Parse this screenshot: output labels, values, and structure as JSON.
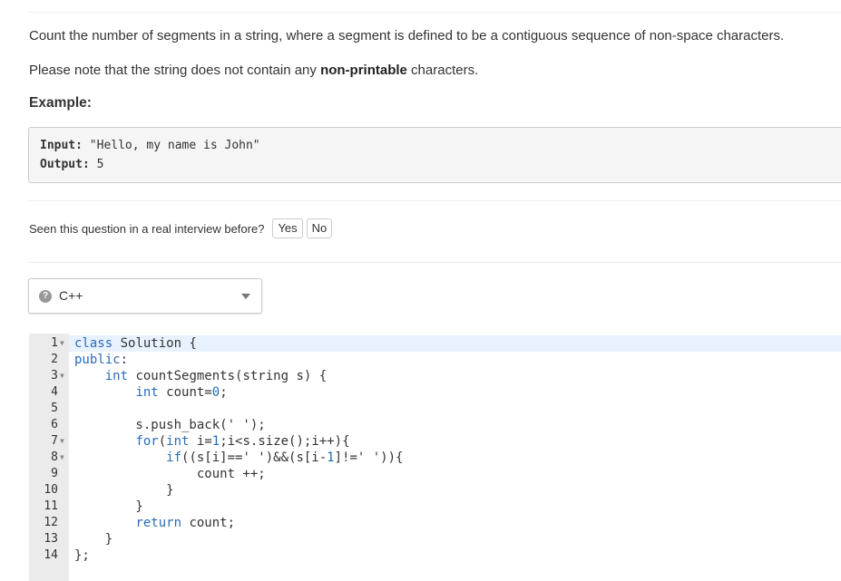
{
  "problem": {
    "description": "Count the number of segments in a string, where a segment is defined to be a contiguous sequence of non-space characters.",
    "note_prefix": "Please note that the string does not contain any ",
    "note_bold": "non-printable",
    "note_suffix": " characters.",
    "example_heading": "Example:",
    "example": {
      "input_label": "Input:",
      "input_value": " \"Hello, my name is John\"",
      "output_label": "Output:",
      "output_value": " 5"
    }
  },
  "interview": {
    "question": "Seen this question in a real interview before?",
    "yes_label": "Yes",
    "no_label": "No"
  },
  "language_select": {
    "icon": "help-icon",
    "icon_glyph": "?",
    "selected": "C++",
    "caret_icon": "caret-down-icon"
  },
  "editor": {
    "active_line": 1,
    "lines": [
      {
        "num": "1",
        "fold": true,
        "code": "class Solution {"
      },
      {
        "num": "2",
        "fold": false,
        "code": "public:"
      },
      {
        "num": "3",
        "fold": true,
        "code": "    int countSegments(string s) {"
      },
      {
        "num": "4",
        "fold": false,
        "code": "        int count=0;"
      },
      {
        "num": "5",
        "fold": false,
        "code": ""
      },
      {
        "num": "6",
        "fold": false,
        "code": "        s.push_back(' ');"
      },
      {
        "num": "7",
        "fold": true,
        "code": "        for(int i=1;i<s.size();i++){"
      },
      {
        "num": "8",
        "fold": true,
        "code": "            if((s[i]==' ')&&(s[i-1]!=' ')){"
      },
      {
        "num": "9",
        "fold": false,
        "code": "                count ++;"
      },
      {
        "num": "10",
        "fold": false,
        "code": "            }"
      },
      {
        "num": "11",
        "fold": false,
        "code": "        }"
      },
      {
        "num": "12",
        "fold": false,
        "code": "        return count;"
      },
      {
        "num": "13",
        "fold": false,
        "code": "    }"
      },
      {
        "num": "14",
        "fold": false,
        "code": "};"
      }
    ]
  },
  "colors": {
    "keyword": "#2c6bb8",
    "active_line_bg": "#e8f2fe",
    "gutter_bg": "#ebebeb",
    "example_bg": "#f5f5f5"
  }
}
